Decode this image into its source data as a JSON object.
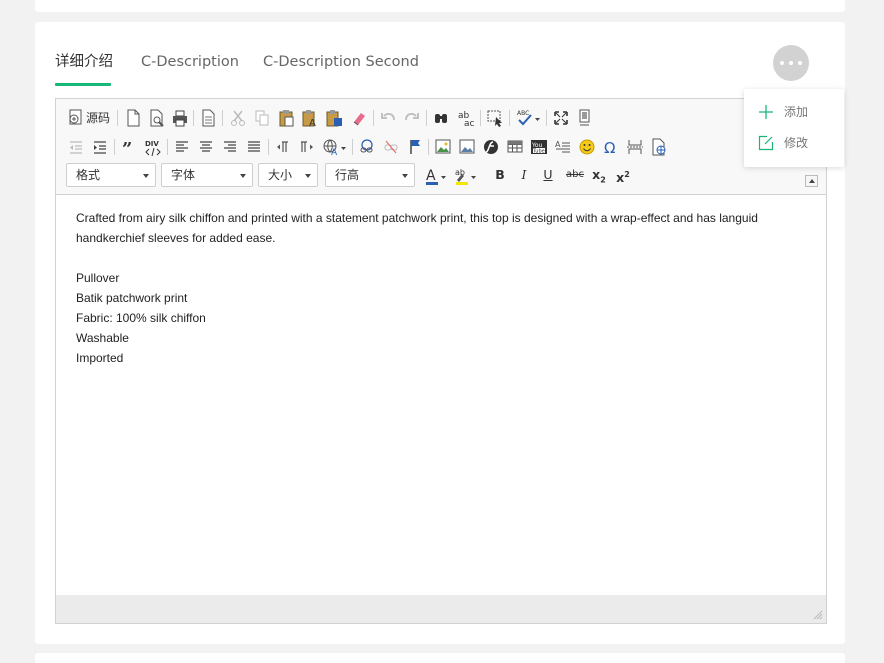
{
  "tabs": [
    {
      "label": "详细介绍",
      "active": true
    },
    {
      "label": "C-Description",
      "active": false
    },
    {
      "label": "C-Description Second",
      "active": false
    }
  ],
  "more_menu": {
    "icon": "ellipsis-icon",
    "items": [
      {
        "label": "添加",
        "icon": "plus-icon"
      },
      {
        "label": "修改",
        "icon": "edit-icon"
      }
    ]
  },
  "toolbar": {
    "source_label": "源码",
    "format_combo": "格式",
    "font_combo": "字体",
    "size_combo": "大小",
    "line_height_combo": "行高",
    "bold": "B",
    "italic": "I",
    "underline": "U",
    "strike": "abc",
    "subscript": "x",
    "subscript_mark": "2",
    "superscript": "x",
    "superscript_mark": "2",
    "div_label": "DIV",
    "abc_label": "ABC"
  },
  "content": {
    "paragraphs": [
      "Crafted from airy silk chiffon and printed with a statement patchwork print, this top is designed with a wrap-effect and has languid handkerchief sleeves for added ease.",
      "",
      "Pullover",
      "Batik patchwork print",
      "Fabric: 100% silk chiffon",
      "Washable",
      "Imported"
    ]
  },
  "colors": {
    "accent": "#16b777",
    "tab_inactive": "#666666",
    "editor_border": "#d1d1d1",
    "status_bar": "#ebebeb"
  }
}
